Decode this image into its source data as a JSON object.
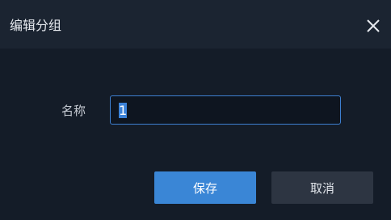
{
  "dialog": {
    "title": "编辑分组",
    "close_icon": "close-icon"
  },
  "form": {
    "name_label": "名称",
    "name_value": "1",
    "name_placeholder": ""
  },
  "buttons": {
    "save_label": "保存",
    "cancel_label": "取消"
  },
  "colors": {
    "dialog_bg": "#141c28",
    "titlebar_bg": "#1b2431",
    "input_border": "#3d7fd0",
    "primary_button": "#3a86d6",
    "secondary_button": "#2d3542",
    "text": "#d8dde5"
  }
}
